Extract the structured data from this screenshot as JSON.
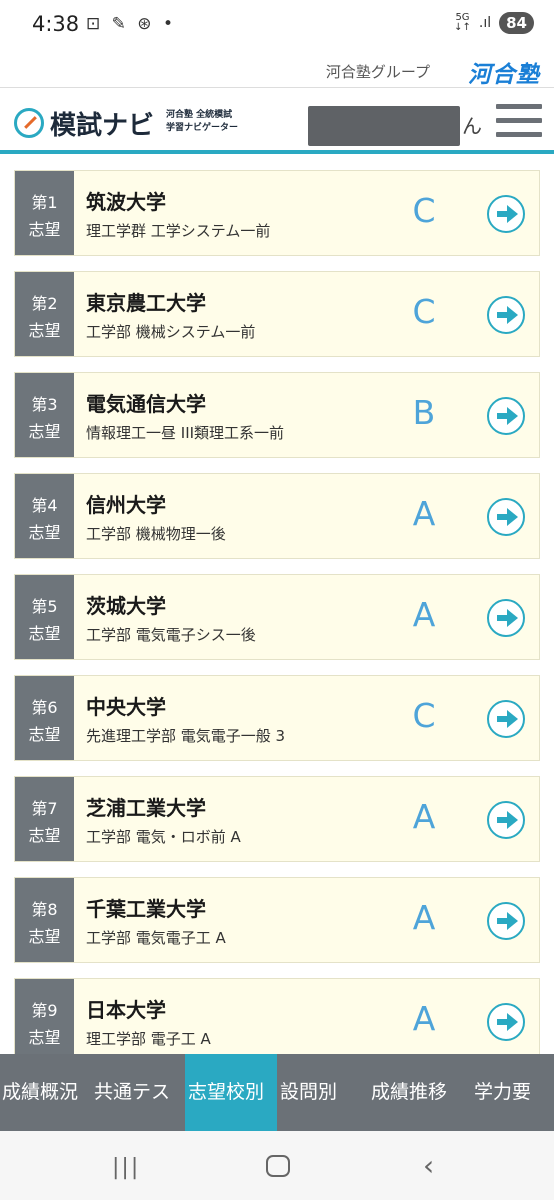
{
  "status_bar": {
    "time": "4:38",
    "left_icons": "⊡ ✎ ⊛ •",
    "network": "5G",
    "network_arrows": "↓↑",
    "signal": ".ıl",
    "battery": "84"
  },
  "group_bar": {
    "group_text": "河合塾グループ",
    "logo_text": "河合塾"
  },
  "header": {
    "title": "模試ナビ",
    "subtitle_line1": "河合塾 全統模試",
    "subtitle_line2": "学習ナビゲーター",
    "name_suffix": "ん"
  },
  "choices": [
    {
      "rank_line1": "第1",
      "rank_line2": "志望",
      "university": "筑波大学",
      "department": "理工学群 工学システム一前",
      "grade": "C"
    },
    {
      "rank_line1": "第2",
      "rank_line2": "志望",
      "university": "東京農工大学",
      "department": "工学部 機械システム一前",
      "grade": "C"
    },
    {
      "rank_line1": "第3",
      "rank_line2": "志望",
      "university": "電気通信大学",
      "department": "情報理工一昼 III類理工系一前",
      "grade": "B"
    },
    {
      "rank_line1": "第4",
      "rank_line2": "志望",
      "university": "信州大学",
      "department": "工学部 機械物理一後",
      "grade": "A"
    },
    {
      "rank_line1": "第5",
      "rank_line2": "志望",
      "university": "茨城大学",
      "department": "工学部 電気電子シス一後",
      "grade": "A"
    },
    {
      "rank_line1": "第6",
      "rank_line2": "志望",
      "university": "中央大学",
      "department": "先進理工学部 電気電子一般 3",
      "grade": "C"
    },
    {
      "rank_line1": "第7",
      "rank_line2": "志望",
      "university": "芝浦工業大学",
      "department": "工学部 電気・ロボ前 A",
      "grade": "A"
    },
    {
      "rank_line1": "第8",
      "rank_line2": "志望",
      "university": "千葉工業大学",
      "department": "工学部 電気電子工 A",
      "grade": "A"
    },
    {
      "rank_line1": "第9",
      "rank_line2": "志望",
      "university": "日本大学",
      "department": "理工学部 電子工 A",
      "grade": "A"
    }
  ],
  "tabs": [
    {
      "label": "成績概況",
      "active": false
    },
    {
      "label": "共通テス",
      "active": false
    },
    {
      "label": "志望校別",
      "active": true
    },
    {
      "label": "設問別",
      "active": false
    },
    {
      "label": "成績推移",
      "active": false
    },
    {
      "label": "学力要",
      "active": false
    }
  ],
  "colors": {
    "accent": "#2aa9c2",
    "grade": "#4ea4d9",
    "rank_bg": "#6e757b",
    "card_bg": "#fffde9",
    "tab_bg": "#6b7177"
  },
  "nav_bar": {
    "recent": "|||",
    "back": "‹"
  }
}
